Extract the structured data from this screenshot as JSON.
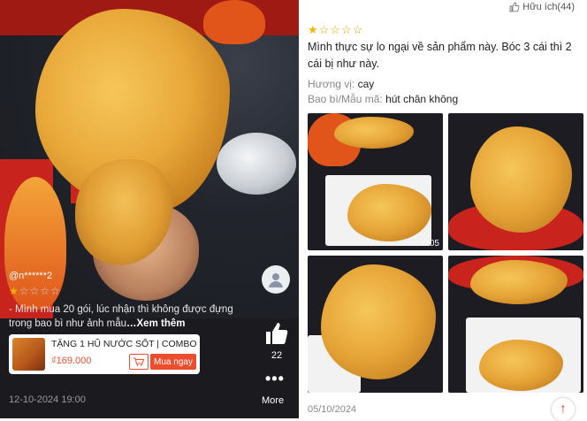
{
  "left_review": {
    "username": "@n******2",
    "rating": 1,
    "max_rating": 5,
    "text": "- Mình mua 20 gói, lúc nhận thì không được đựng trong bao bì như ảnh mẫu",
    "see_more": "…Xem thêm",
    "date": "12-10-2024 19:00",
    "like_count": "22",
    "more_label": "More",
    "product": {
      "title": "TẶNG 1 HŨ NƯỚC SỐT | COMBO...",
      "price": "₫169.000",
      "buy_label": "Mua ngay"
    },
    "colors": {
      "accent": "#ee4d2d",
      "star": "#f5b301"
    },
    "icons": [
      "avatar-icon",
      "thumbs-up-icon",
      "more-dots-icon",
      "cart-icon"
    ]
  },
  "right_review": {
    "helpful_label": "Hữu ích(44)",
    "rating": 1,
    "max_rating": 5,
    "text": "Mình thực sự lo ngại về sản phẩm này. Bóc 3 cái thì 2 cái bị như này.",
    "attributes": [
      {
        "key": "Hương vị:",
        "value": "cay"
      },
      {
        "key": "Bao bì/Mẫu mã:",
        "value": "hút chân không"
      }
    ],
    "video_duration": "0:05",
    "date": "05/10/2024",
    "icons": [
      "thumbs-up-icon",
      "scroll-top-icon"
    ]
  }
}
